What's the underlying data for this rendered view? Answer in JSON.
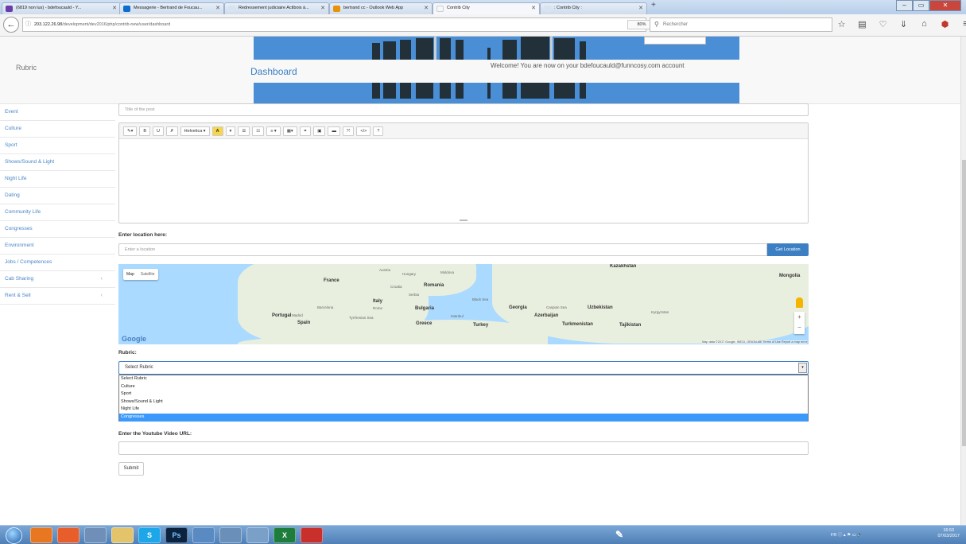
{
  "browser": {
    "tabs": [
      {
        "label": "(6819 non lus) - bdefoucauld - Y...",
        "active": false,
        "fav_color": "#6a3da8"
      },
      {
        "label": "Messagerie - Bertrand de Foucau...",
        "active": false,
        "fav_color": "#0c6dcf"
      },
      {
        "label": "Redressement judiciaire Actibois à...",
        "active": false,
        "fav_color": "#d8e3f0"
      },
      {
        "label": "bertrand cc - Outlook Web App",
        "active": false,
        "fav_color": "#e8920a"
      },
      {
        "label": "Contrib City",
        "active": true,
        "fav_color": "#f5f7fa"
      },
      {
        "label": ": Contrib City :",
        "active": false,
        "fav_color": "#d8e3f0"
      }
    ],
    "url_host": "203.122.26.98",
    "url_path": "/development/dev2016/php/contrib-new/user/dashboard",
    "zoom": "80%",
    "search_placeholder": "Rechercher"
  },
  "site": {
    "brand": "Rubric",
    "dashboard_title": "Dashboard",
    "welcome": "Welcome! You are now on your bdefoucauld@funncosy.com account"
  },
  "sidebar": {
    "items": [
      {
        "label": "Event",
        "chevron": false
      },
      {
        "label": "Culture",
        "chevron": false
      },
      {
        "label": "Sport",
        "chevron": false
      },
      {
        "label": "Shows/Sound & Light",
        "chevron": false
      },
      {
        "label": "Night Life",
        "chevron": false
      },
      {
        "label": "Dating",
        "chevron": false
      },
      {
        "label": "Community Life",
        "chevron": false
      },
      {
        "label": "Congresses",
        "chevron": false
      },
      {
        "label": "Environment",
        "chevron": false
      },
      {
        "label": "Jobs / Competences",
        "chevron": false
      },
      {
        "label": "Cab Sharing",
        "chevron": true
      },
      {
        "label": "Rent & Sell",
        "chevron": true
      }
    ]
  },
  "form": {
    "title_placeholder": "Title of the post",
    "editor_buttons": [
      "✎▾",
      "B",
      "U",
      "✗",
      "Helvetica ▾",
      "A",
      "▾",
      "☰",
      "☷",
      "≡ ▾",
      "▦▾",
      "⚭",
      "▣",
      "▬",
      "⤧",
      "</>",
      "?"
    ],
    "location_label": "Enter location here:",
    "location_placeholder": "Enter a location",
    "get_location_button": "Get Location",
    "rubric_label": "Rubric:",
    "rubric_selected": "Select Rubric",
    "rubric_options": [
      "Select Rubric",
      "Culture",
      "Sport",
      "Shows/Sound & Light",
      "Night Life",
      "Congresses"
    ],
    "rubric_highlighted_index": 5,
    "youtube_label": "Enter the Youtube Video URL:",
    "youtube_value": "",
    "submit_label": "Submit"
  },
  "map": {
    "type_map": "Map",
    "type_satellite": "Satellite",
    "logo": "Google",
    "credits": "Map data ©2017 Google, INEGI, ORION-ME   Terms of Use   Report a map error",
    "labels": [
      "France",
      "Romania",
      "Italy",
      "Portugal",
      "Spain",
      "Bulgaria",
      "Greece",
      "Turkey",
      "Georgia",
      "Azerbaijan",
      "Uzbekistan",
      "Turkmenistan",
      "Tajikistan",
      "Kazakhstan",
      "Mongolia"
    ],
    "small_labels": [
      "Austria",
      "Hungary",
      "Moldova",
      "Croatia",
      "Serbia",
      "Barcelona",
      "Madrid",
      "Rome",
      "Istanbul",
      "Black Sea",
      "Caspian Sea",
      "Kyrgyzstan",
      "Tyrrhenian Sea"
    ]
  },
  "taskbar": {
    "apps": [
      "",
      "",
      "",
      "",
      "S",
      "Ps",
      "",
      "",
      "",
      "X",
      ""
    ],
    "lang": "FR",
    "time": "16:53",
    "date": "07/03/2017"
  }
}
